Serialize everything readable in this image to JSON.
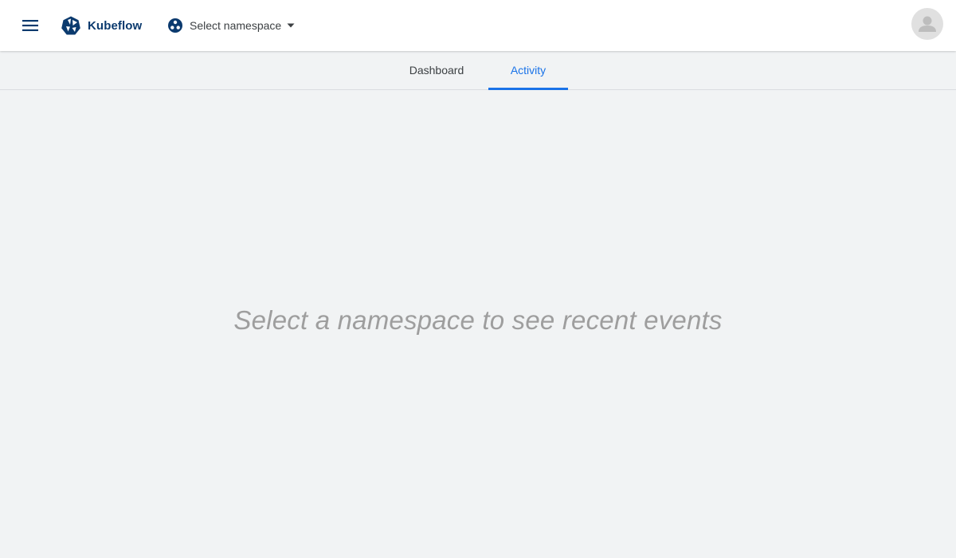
{
  "header": {
    "app_name": "Kubeflow",
    "namespace_selector": {
      "label": "Select namespace"
    }
  },
  "tabs": [
    {
      "label": "Dashboard",
      "active": false
    },
    {
      "label": "Activity",
      "active": true
    }
  ],
  "main": {
    "empty_message": "Select a namespace to see recent events"
  },
  "icons": {
    "menu": "menu-icon",
    "logo": "kubeflow-logo-icon",
    "namespace": "namespace-icon",
    "caret": "arrow-drop-down-icon",
    "avatar": "account-circle-icon"
  },
  "colors": {
    "accent": "#1a73e8",
    "brand": "#0b3a6e",
    "background": "#f1f3f4"
  }
}
